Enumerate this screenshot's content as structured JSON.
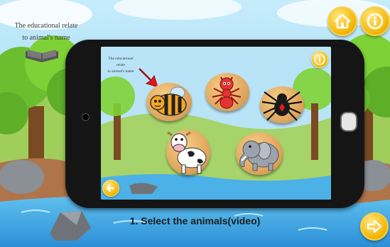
{
  "app": {
    "notice_line1": "The educational relate",
    "notice_line2": "to animal's name",
    "instruction": "1. Select the animals(video)"
  },
  "screen": {
    "notice_line1": "The educational relate",
    "notice_line2": "to animal's name"
  },
  "animals": [
    {
      "name": "bee-button"
    },
    {
      "name": "ant-button"
    },
    {
      "name": "spider-button"
    },
    {
      "name": "cow-button"
    },
    {
      "name": "elephant-button"
    }
  ],
  "colors": {
    "sky": "#8fd3f4",
    "water": "#3aa6e0",
    "gold_button": "#f4b400",
    "phone_body": "#151515"
  },
  "icons": [
    "home-icon",
    "info-icon",
    "next-arrow-icon",
    "back-arrow-icon",
    "book-icon",
    "pointer-arrow-icon"
  ]
}
